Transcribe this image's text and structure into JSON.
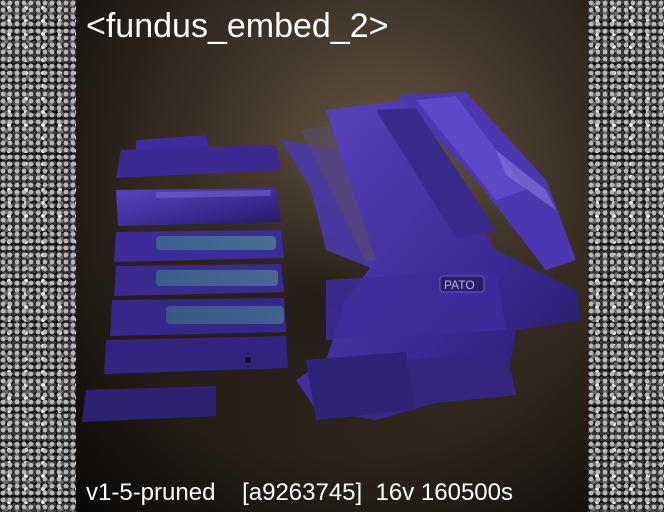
{
  "image": {
    "title": "<fundus_embed_2>",
    "caption": "v1-5-pruned    [a9263745]  16v 160500s"
  },
  "colors": {
    "background": "#000000",
    "text": "#ffffff",
    "object_purple": "#3f2d9a",
    "object_teal": "#3e6f8a"
  }
}
